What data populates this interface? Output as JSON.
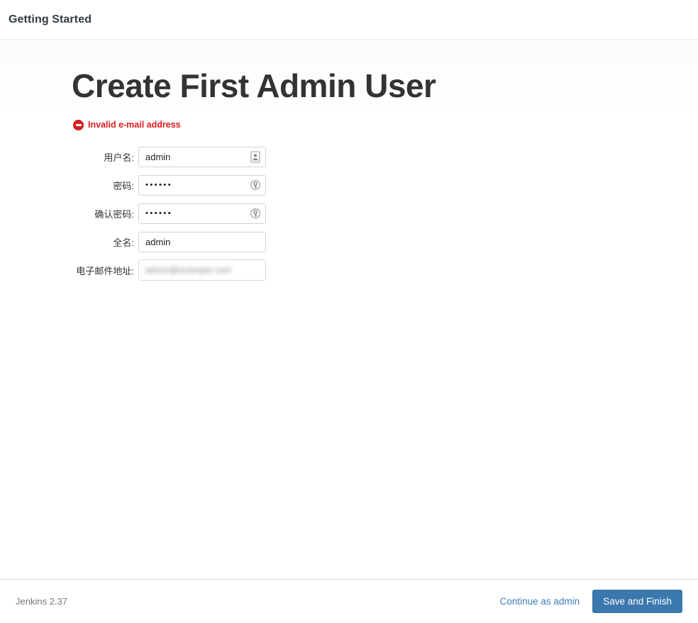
{
  "header": {
    "title": "Getting Started"
  },
  "setup": {
    "page_title": "Create First Admin User",
    "error": {
      "icon": "error-circle-icon",
      "message": "Invalid e-mail address"
    },
    "fields": [
      {
        "key": "username",
        "label": "用户名:",
        "type": "text",
        "value": "admin",
        "placeholder": "",
        "icon": "contact-card-icon"
      },
      {
        "key": "password",
        "label": "密码:",
        "type": "password",
        "value": "••••••",
        "placeholder": "",
        "icon": "key-circle-icon"
      },
      {
        "key": "confirm_password",
        "label": "确认密码:",
        "type": "password",
        "value": "••••••",
        "placeholder": "",
        "icon": "key-circle-icon"
      },
      {
        "key": "fullname",
        "label": "全名:",
        "type": "text",
        "value": "admin",
        "placeholder": "",
        "icon": ""
      },
      {
        "key": "email",
        "label": "电子邮件地址:",
        "type": "email",
        "value": "admin@example.com",
        "placeholder": "",
        "icon": "",
        "redacted": true
      }
    ]
  },
  "footer": {
    "version": "Jenkins 2.37",
    "continue_link": "Continue as admin",
    "save_button": "Save and Finish"
  },
  "colors": {
    "accent": "#3b78ad",
    "link": "#3d7cb8",
    "error": "#e01b1b",
    "header_text": "#333b44",
    "border": "#d8d8d8"
  }
}
